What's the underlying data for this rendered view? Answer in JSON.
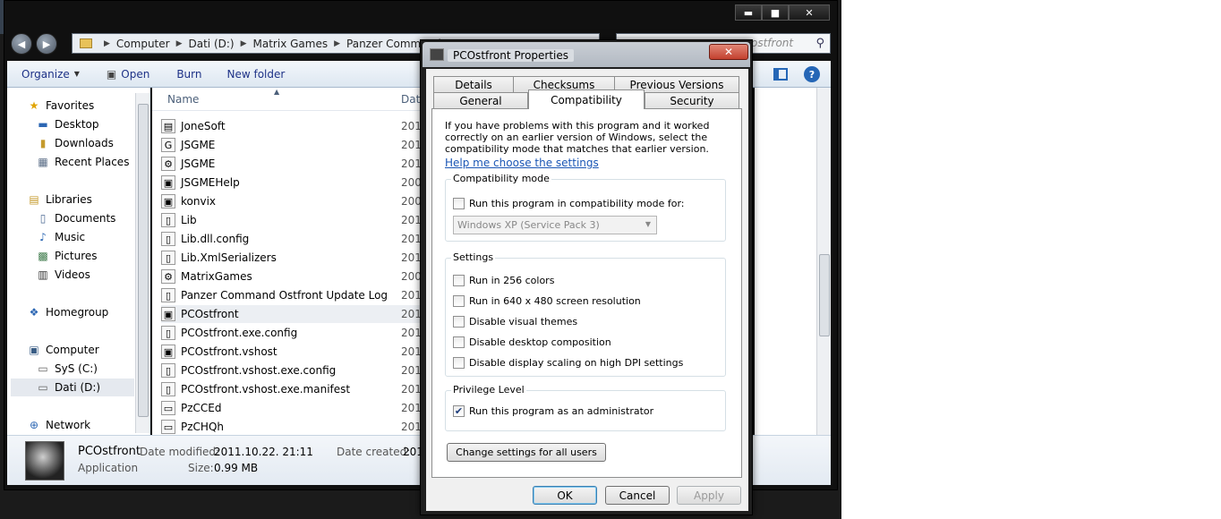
{
  "explorer": {
    "caption": {
      "minimize": "▬",
      "maximize": "■",
      "close": "✕"
    },
    "breadcrumbs": [
      "Computer",
      "Dati (D:)",
      "Matrix Games",
      "Panzer Command O"
    ],
    "search_placeholder": "ostfront",
    "toolbar": {
      "organize": "Organize",
      "open": "Open",
      "burn": "Burn",
      "new_folder": "New folder"
    },
    "nav": {
      "favorites": "Favorites",
      "desktop": "Desktop",
      "downloads": "Downloads",
      "recent_places": "Recent Places",
      "libraries": "Libraries",
      "documents": "Documents",
      "music": "Music",
      "pictures": "Pictures",
      "videos": "Videos",
      "homegroup": "Homegroup",
      "computer": "Computer",
      "sys_c": "SyS (C:)",
      "dati_d": "Dati (D:)",
      "network": "Network"
    },
    "columns": {
      "name": "Name",
      "date": "Dat"
    },
    "files": [
      {
        "name": "JoneSoft",
        "date": "201"
      },
      {
        "name": "JSGME",
        "date": "201"
      },
      {
        "name": "JSGME",
        "date": "201"
      },
      {
        "name": "JSGMEHelp",
        "date": "200"
      },
      {
        "name": "konvix",
        "date": "200"
      },
      {
        "name": "Lib",
        "date": "201"
      },
      {
        "name": "Lib.dll.config",
        "date": "201"
      },
      {
        "name": "Lib.XmlSerializers",
        "date": "201"
      },
      {
        "name": "MatrixGames",
        "date": "200"
      },
      {
        "name": "Panzer Command Ostfront Update Log",
        "date": "201"
      },
      {
        "name": "PCOstfront",
        "date": "201"
      },
      {
        "name": "PCOstfront.exe.config",
        "date": "201"
      },
      {
        "name": "PCOstfront.vshost",
        "date": "201"
      },
      {
        "name": "PCOstfront.vshost.exe.config",
        "date": "201"
      },
      {
        "name": "PCOstfront.vshost.exe.manifest",
        "date": "201"
      },
      {
        "name": "PzCCEd",
        "date": "201"
      },
      {
        "name": "PzCHQh",
        "date": "201"
      }
    ],
    "details": {
      "name": "PCOstfront",
      "type": "Application",
      "modified_label": "Date modified:",
      "modified_value": "2011.10.22. 21:11",
      "size_label": "Size:",
      "size_value": "0.99 MB",
      "created_label": "Date created:",
      "created_value": "201"
    }
  },
  "dialog": {
    "title": "PCOstfront Properties",
    "close": "✕",
    "tabs": {
      "details": "Details",
      "checksums": "Checksums",
      "previous_versions": "Previous Versions",
      "general": "General",
      "compatibility": "Compatibility",
      "security": "Security"
    },
    "intro": "If you have problems with this program and it worked correctly on an earlier version of Windows, select the compatibility mode that matches that earlier version.",
    "help_link": "Help me choose the settings",
    "compat_group": {
      "label": "Compatibility mode",
      "checkbox": "Run this program in compatibility mode for:",
      "checked": false,
      "select_value": "Windows XP (Service Pack 3)"
    },
    "settings_group": {
      "label": "Settings",
      "options": [
        {
          "label": "Run in 256 colors",
          "checked": false
        },
        {
          "label": "Run in 640 x 480 screen resolution",
          "checked": false
        },
        {
          "label": "Disable visual themes",
          "checked": false
        },
        {
          "label": "Disable desktop composition",
          "checked": false
        },
        {
          "label": "Disable display scaling on high DPI settings",
          "checked": false
        }
      ]
    },
    "privilege_group": {
      "label": "Privilege Level",
      "checkbox": "Run this program as an administrator",
      "checked": true
    },
    "change_all_button": "Change settings for all users",
    "buttons": {
      "ok": "OK",
      "cancel": "Cancel",
      "apply": "Apply"
    }
  }
}
